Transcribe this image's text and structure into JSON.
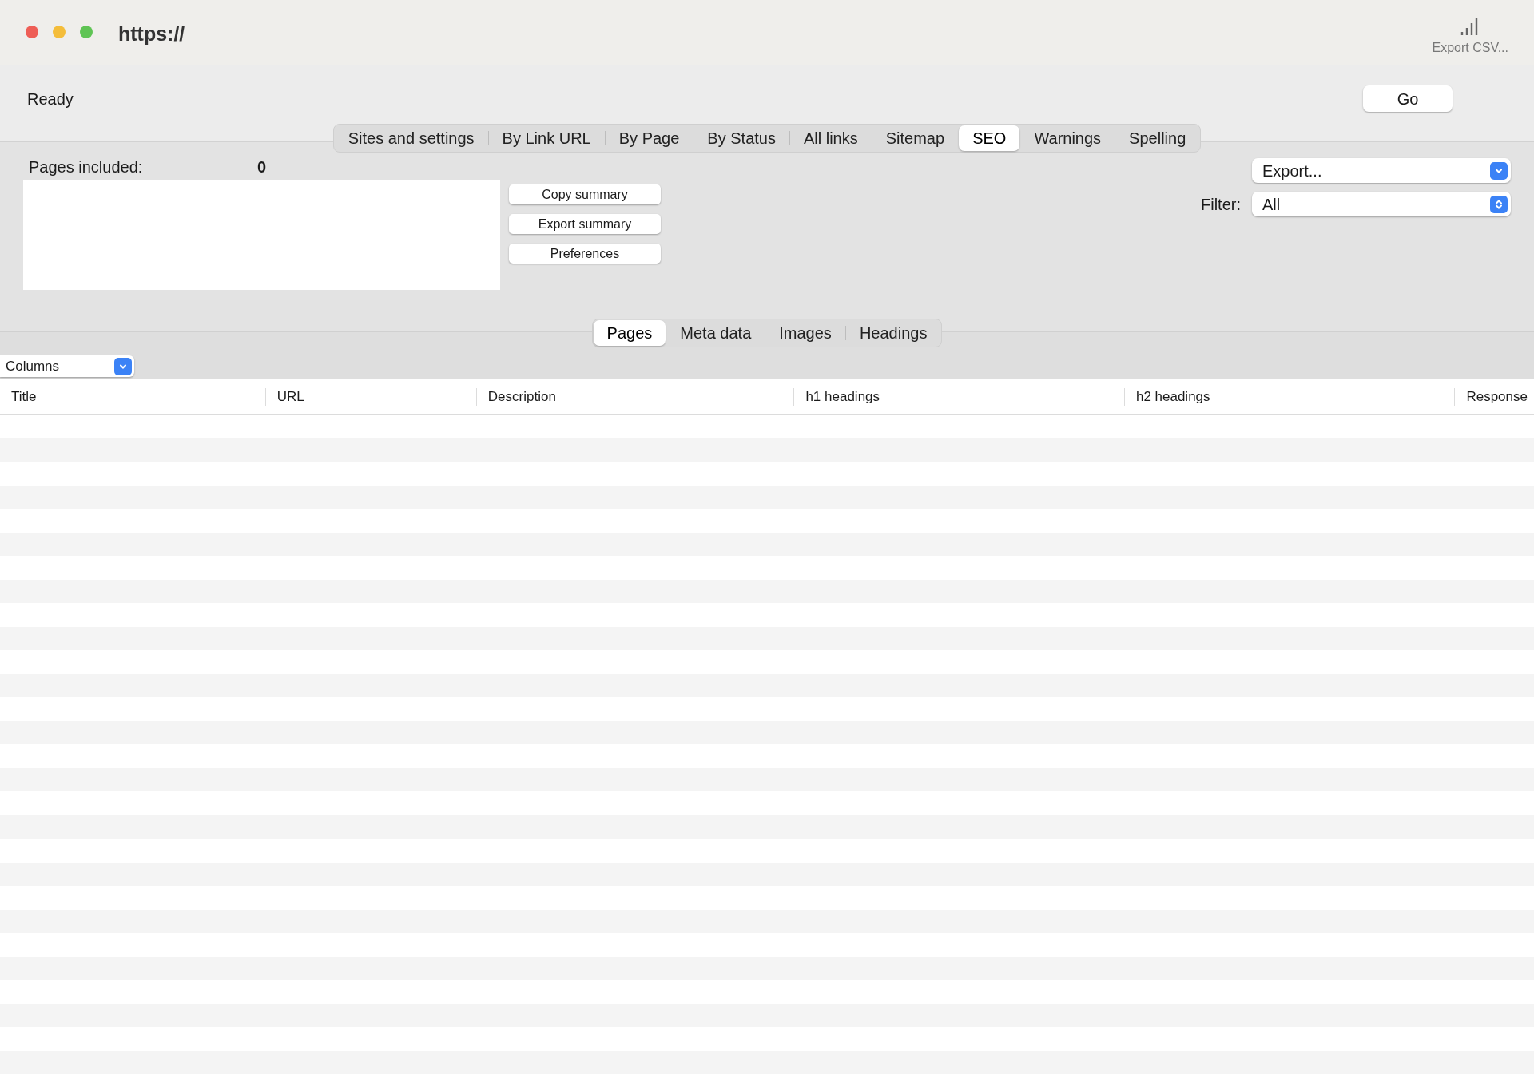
{
  "window": {
    "title": "https://",
    "toolbar_button": "Export CSV..."
  },
  "status": {
    "text": "Ready",
    "go_button": "Go"
  },
  "tabs": [
    {
      "label": "Sites and settings",
      "selected": false
    },
    {
      "label": "By Link URL",
      "selected": false
    },
    {
      "label": "By Page",
      "selected": false
    },
    {
      "label": "By Status",
      "selected": false
    },
    {
      "label": "All links",
      "selected": false
    },
    {
      "label": "Sitemap",
      "selected": false
    },
    {
      "label": "SEO",
      "selected": true
    },
    {
      "label": "Warnings",
      "selected": false
    },
    {
      "label": "Spelling",
      "selected": false
    }
  ],
  "summary": {
    "label": "Pages included:",
    "value": "0",
    "buttons": [
      "Copy summary",
      "Export summary",
      "Preferences"
    ]
  },
  "export_select": {
    "value": "Export..."
  },
  "filter": {
    "label": "Filter:",
    "value": "All"
  },
  "sub_tabs": [
    {
      "label": "Pages",
      "selected": true
    },
    {
      "label": "Meta data",
      "selected": false
    },
    {
      "label": "Images",
      "selected": false
    },
    {
      "label": "Headings",
      "selected": false
    }
  ],
  "columns_select": {
    "value": "Columns"
  },
  "table": {
    "columns": [
      "Title",
      "URL",
      "Description",
      "h1 headings",
      "h2 headings",
      "Response"
    ]
  }
}
